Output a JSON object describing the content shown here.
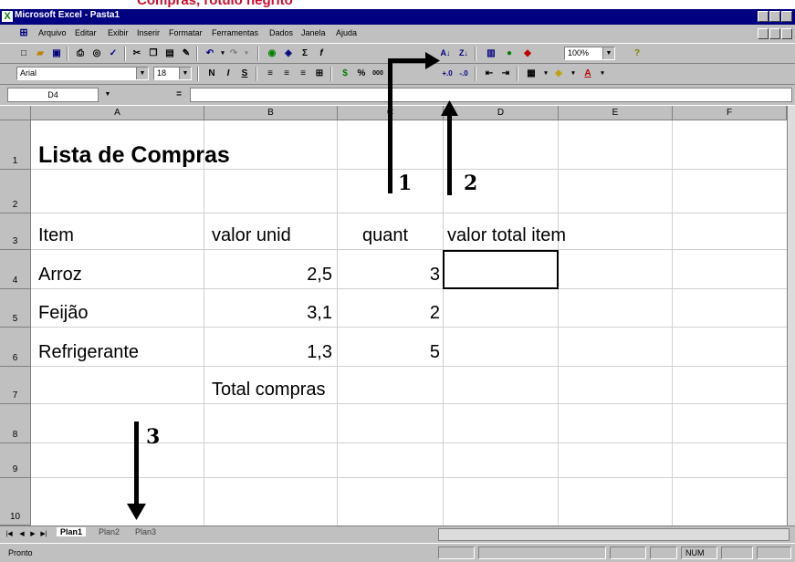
{
  "page_heading": "Compras, rótulo negrito",
  "app": {
    "title": "Microsoft Excel - Pasta1"
  },
  "menu": {
    "items": [
      "Arquivo",
      "Editar",
      "Exibir",
      "Inserir",
      "Formatar",
      "Ferramentas",
      "Dados",
      "Janela",
      "Ajuda"
    ]
  },
  "toolbar": {
    "zoom": "100%",
    "font_name": "Arial",
    "font_size": "18",
    "bold": "N",
    "italic": "I",
    "underline": "S",
    "percent": "%",
    "thousands": "000"
  },
  "formula_bar": {
    "cell_ref": "D4",
    "equals": "=",
    "value": ""
  },
  "columns": [
    "A",
    "B",
    "C",
    "D",
    "E",
    "F"
  ],
  "rows": [
    "1",
    "2",
    "3",
    "4",
    "5",
    "6",
    "7",
    "8",
    "9",
    "10"
  ],
  "sheet": {
    "title": "Lista de Compras",
    "headers": {
      "item": "Item",
      "unit_value": "valor unid",
      "quantity": "quant",
      "total_item": "valor total item"
    },
    "items": [
      {
        "name": "Arroz",
        "unit": "2,5",
        "qty": "3"
      },
      {
        "name": "Feijão",
        "unit": "3,1",
        "qty": "2"
      },
      {
        "name": "Refrigerante",
        "unit": "1,3",
        "qty": "5"
      }
    ],
    "total_label": "Total compras"
  },
  "sheet_tabs": [
    "Plan1",
    "Plan2",
    "Plan3"
  ],
  "status": {
    "ready": "Pronto",
    "num": "NUM"
  },
  "annotations": {
    "arrow1": "1",
    "arrow2": "2",
    "arrow3": "3"
  },
  "colors": {
    "title_bar": "#000080",
    "chrome": "#c0c0c0",
    "heading_red": "#c8102e"
  }
}
